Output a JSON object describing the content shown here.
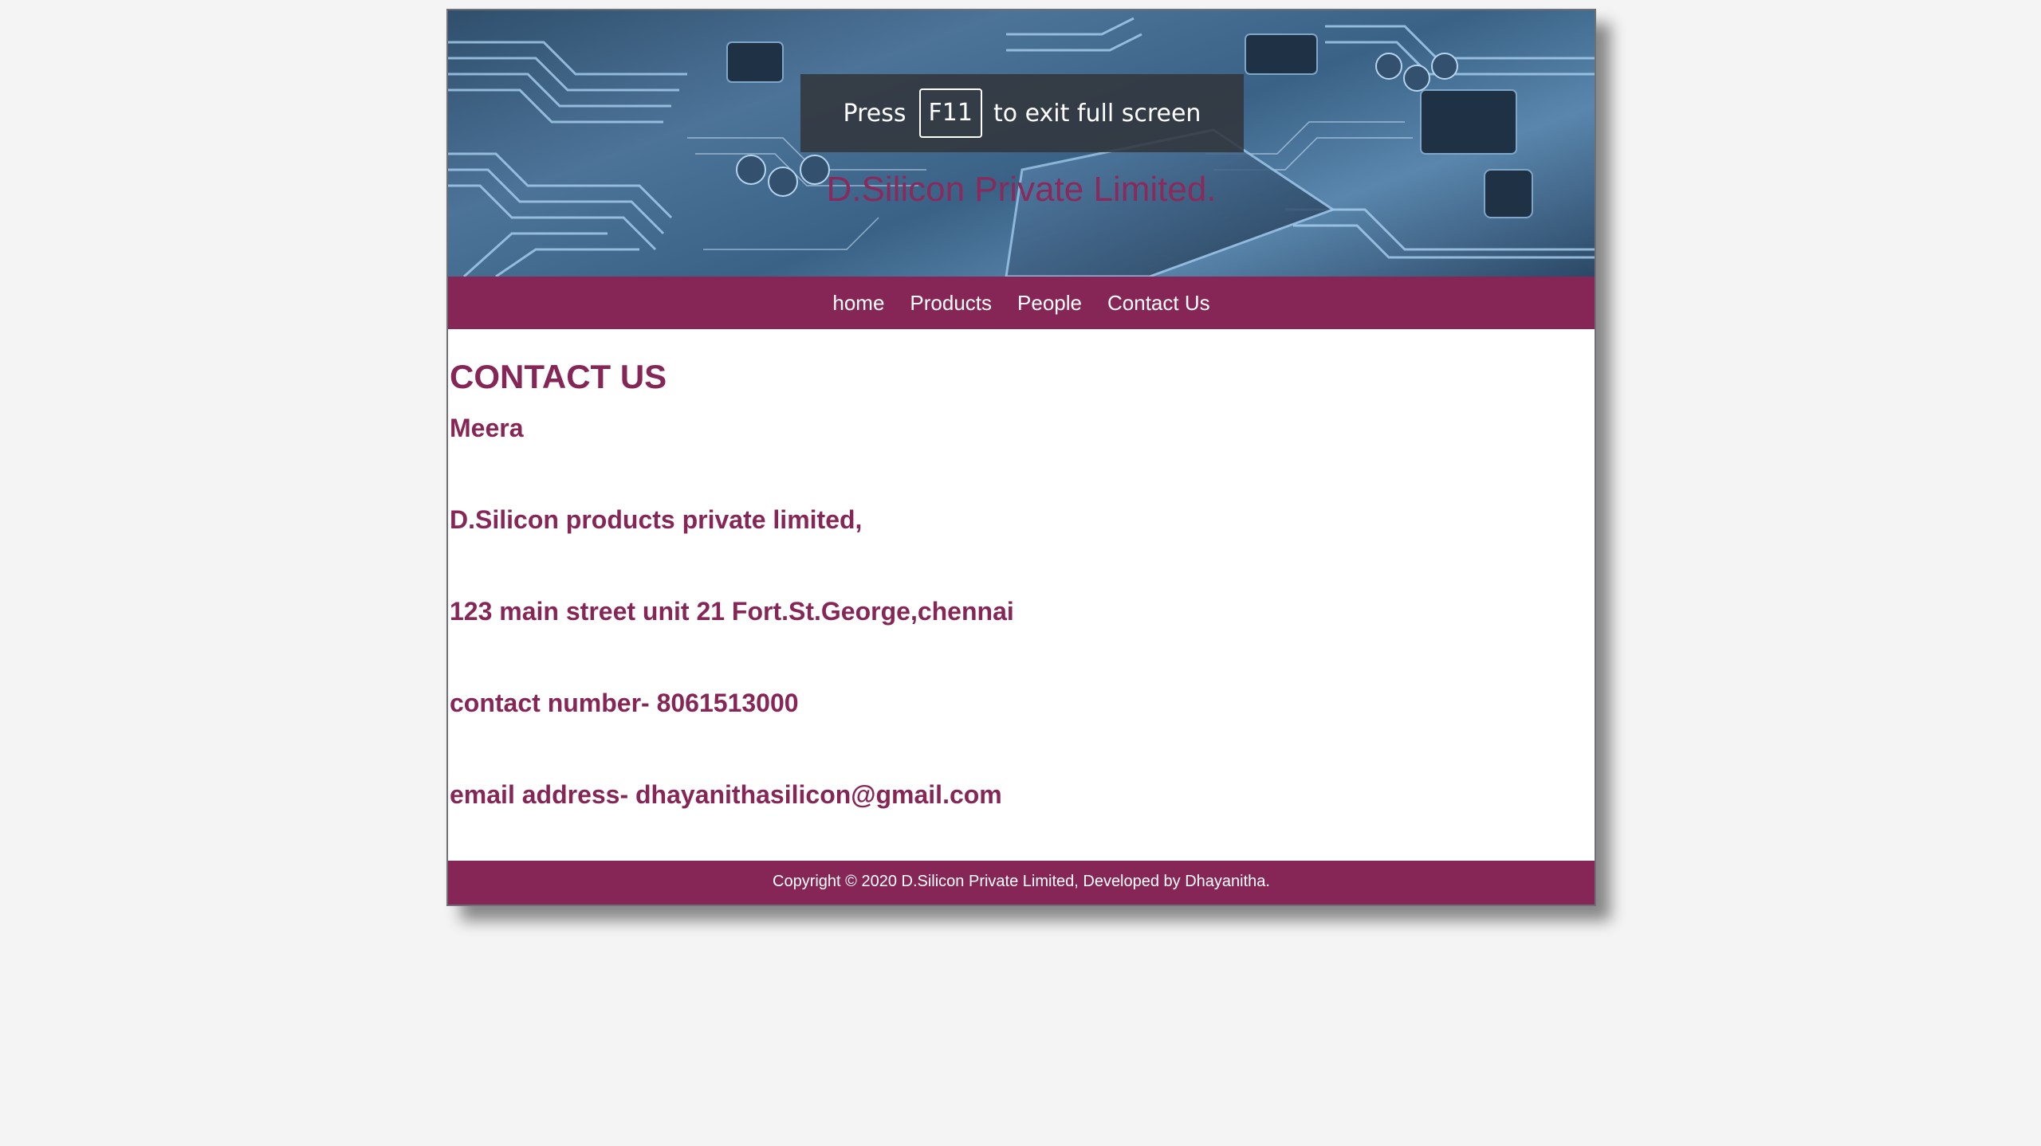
{
  "header": {
    "company_title": "D.Silicon Private Limited."
  },
  "fullscreen_notice": {
    "prefix": "Press",
    "key": "F11",
    "suffix": "to exit full screen"
  },
  "nav": {
    "items": [
      {
        "label": "home"
      },
      {
        "label": "Products"
      },
      {
        "label": "People"
      },
      {
        "label": "Contact Us"
      }
    ]
  },
  "contact": {
    "heading": "CONTACT US",
    "name": "Meera",
    "company": "D.Silicon products private limited,",
    "address": "123 main street unit 21 Fort.St.George,chennai",
    "phone": "contact number- 8061513000",
    "email": "email address- dhayanithasilicon@gmail.com"
  },
  "footer": {
    "copyright": "Copyright © 2020 D.Silicon Private Limited, Developed by Dhayanitha."
  },
  "colors": {
    "brand": "#852656",
    "background": "#f4f4f4"
  }
}
